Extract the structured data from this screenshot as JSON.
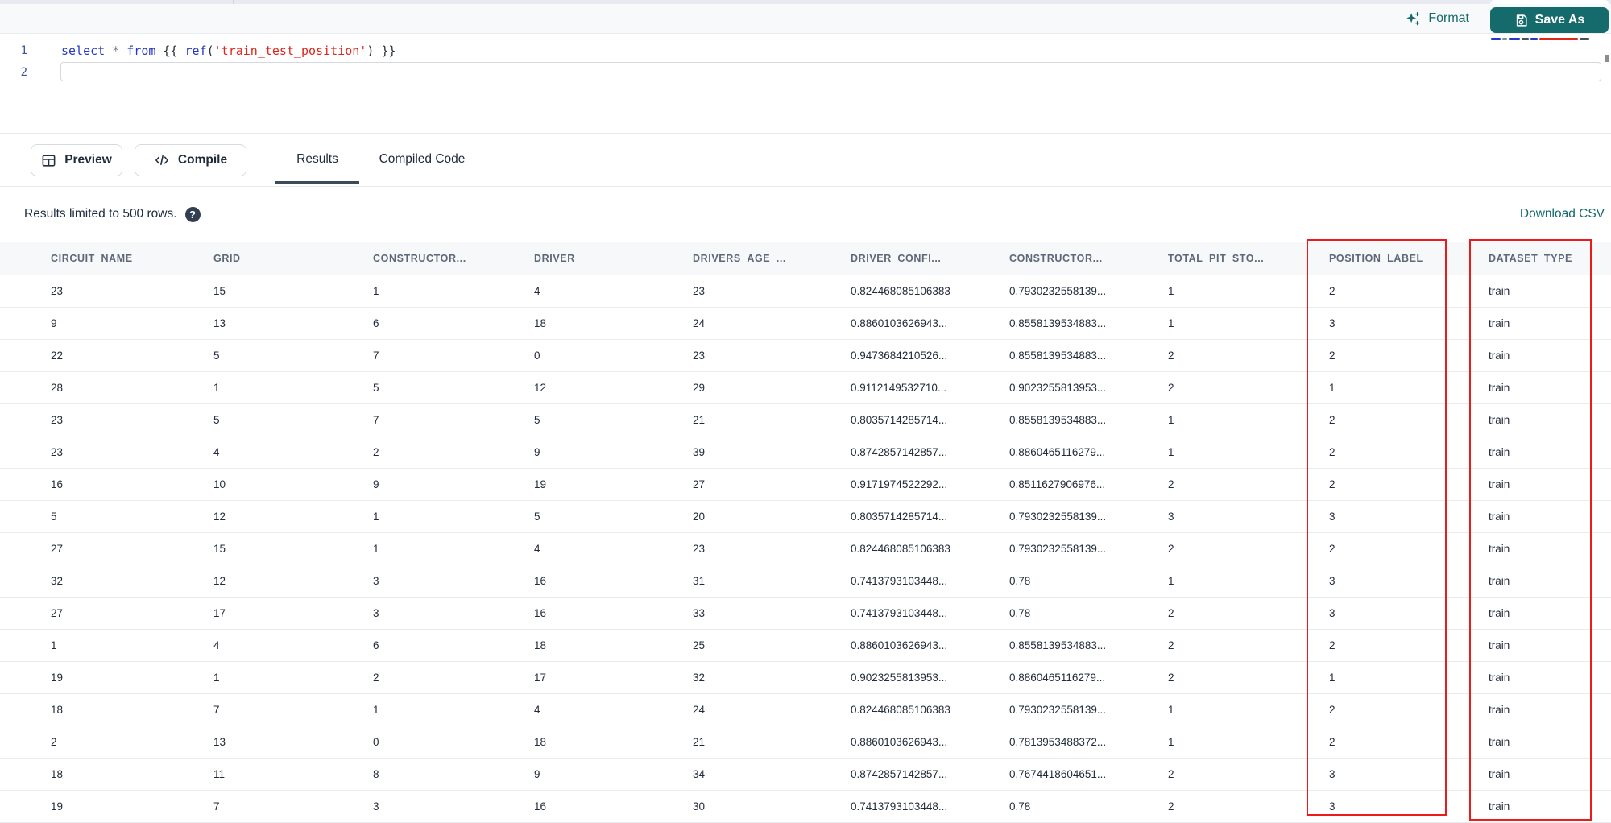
{
  "toolbar": {
    "format_label": "Format",
    "save_as_label": "Save As"
  },
  "editor": {
    "lines": [
      {
        "number": "1",
        "tokens": [
          {
            "t": "select",
            "c": "kw"
          },
          {
            "t": " ",
            "c": "pl"
          },
          {
            "t": "*",
            "c": "op"
          },
          {
            "t": " ",
            "c": "pl"
          },
          {
            "t": "from",
            "c": "kw"
          },
          {
            "t": " {{ ",
            "c": "pl"
          },
          {
            "t": "ref",
            "c": "fn"
          },
          {
            "t": "(",
            "c": "pl"
          },
          {
            "t": "'train_test_position'",
            "c": "str"
          },
          {
            "t": ") }}",
            "c": "pl"
          }
        ]
      },
      {
        "number": "2",
        "tokens": []
      }
    ]
  },
  "actions": {
    "preview_label": "Preview",
    "compile_label": "Compile"
  },
  "tabs": [
    {
      "label": "Results",
      "active": true
    },
    {
      "label": "Compiled Code",
      "active": false
    }
  ],
  "results_meta": {
    "limit_text": "Results limited to 500 rows.",
    "help_glyph": "?",
    "download_label": "Download CSV"
  },
  "table": {
    "columns": [
      "CIRCUIT_NAME",
      "GRID",
      "CONSTRUCTOR...",
      "DRIVER",
      "DRIVERS_AGE_...",
      "DRIVER_CONFI...",
      "CONSTRUCTOR...",
      "TOTAL_PIT_STO...",
      "POSITION_LABEL",
      "DATASET_TYPE"
    ],
    "highlighted_columns": [
      "POSITION_LABEL",
      "DATASET_TYPE"
    ],
    "rows": [
      [
        "23",
        "15",
        "1",
        "4",
        "23",
        "0.824468085106383",
        "0.7930232558139...",
        "1",
        "2",
        "train"
      ],
      [
        "9",
        "13",
        "6",
        "18",
        "24",
        "0.8860103626943...",
        "0.8558139534883...",
        "1",
        "3",
        "train"
      ],
      [
        "22",
        "5",
        "7",
        "0",
        "23",
        "0.9473684210526...",
        "0.8558139534883...",
        "2",
        "2",
        "train"
      ],
      [
        "28",
        "1",
        "5",
        "12",
        "29",
        "0.9112149532710...",
        "0.9023255813953...",
        "2",
        "1",
        "train"
      ],
      [
        "23",
        "5",
        "7",
        "5",
        "21",
        "0.8035714285714...",
        "0.8558139534883...",
        "1",
        "2",
        "train"
      ],
      [
        "23",
        "4",
        "2",
        "9",
        "39",
        "0.8742857142857...",
        "0.8860465116279...",
        "1",
        "2",
        "train"
      ],
      [
        "16",
        "10",
        "9",
        "19",
        "27",
        "0.9171974522292...",
        "0.8511627906976...",
        "2",
        "2",
        "train"
      ],
      [
        "5",
        "12",
        "1",
        "5",
        "20",
        "0.8035714285714...",
        "0.7930232558139...",
        "3",
        "3",
        "train"
      ],
      [
        "27",
        "15",
        "1",
        "4",
        "23",
        "0.824468085106383",
        "0.7930232558139...",
        "2",
        "2",
        "train"
      ],
      [
        "32",
        "12",
        "3",
        "16",
        "31",
        "0.7413793103448...",
        "0.78",
        "1",
        "3",
        "train"
      ],
      [
        "27",
        "17",
        "3",
        "16",
        "33",
        "0.7413793103448...",
        "0.78",
        "2",
        "3",
        "train"
      ],
      [
        "1",
        "4",
        "6",
        "18",
        "25",
        "0.8860103626943...",
        "0.8558139534883...",
        "2",
        "2",
        "train"
      ],
      [
        "19",
        "1",
        "2",
        "17",
        "32",
        "0.9023255813953...",
        "0.8860465116279...",
        "2",
        "1",
        "train"
      ],
      [
        "18",
        "7",
        "1",
        "4",
        "24",
        "0.824468085106383",
        "0.7930232558139...",
        "1",
        "2",
        "train"
      ],
      [
        "2",
        "13",
        "0",
        "18",
        "21",
        "0.8860103626943...",
        "0.7813953488372...",
        "1",
        "2",
        "train"
      ],
      [
        "18",
        "11",
        "8",
        "9",
        "34",
        "0.8742857142857...",
        "0.7674418604651...",
        "2",
        "3",
        "train"
      ],
      [
        "19",
        "7",
        "3",
        "16",
        "30",
        "0.7413793103448...",
        "0.78",
        "2",
        "3",
        "train"
      ]
    ]
  },
  "colors": {
    "accent_teal": "#156A6C",
    "highlight_red": "#EC1A1A",
    "keyword_blue": "#2638C8",
    "string_red": "#DE261C"
  }
}
